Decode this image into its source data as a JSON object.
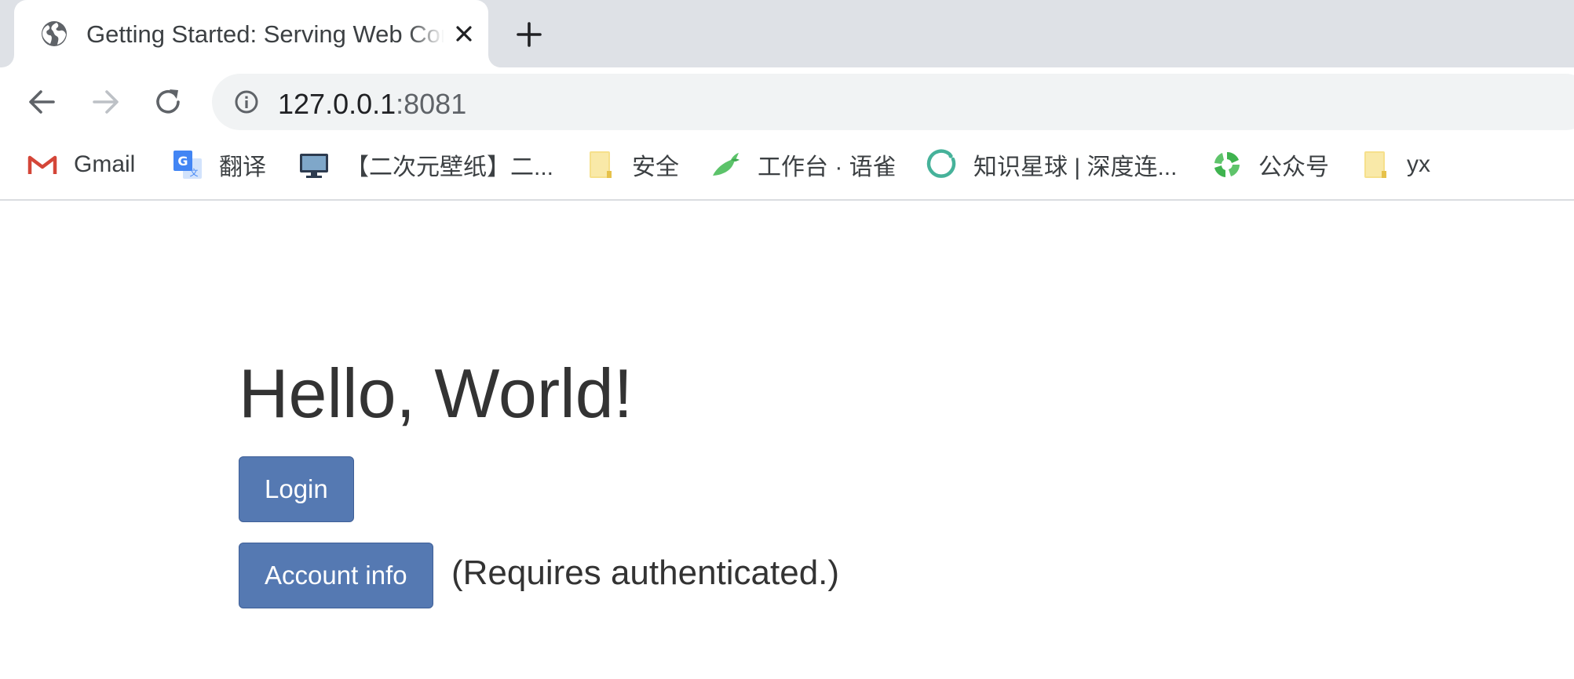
{
  "browser": {
    "tab": {
      "title": "Getting Started: Serving Web Content",
      "favicon": "globe-icon"
    },
    "address": {
      "host": "127.0.0.1",
      "port": ":8081"
    },
    "bookmarks": [
      {
        "label": "Gmail",
        "icon": "gmail-icon"
      },
      {
        "label": "翻译",
        "icon": "translate-icon"
      },
      {
        "label": "【二次元壁纸】二...",
        "icon": "monitor-icon"
      },
      {
        "label": "安全",
        "icon": "folder-icon"
      },
      {
        "label": "工作台 · 语雀",
        "icon": "yuque-icon"
      },
      {
        "label": "知识星球 | 深度连...",
        "icon": "zsxq-icon"
      },
      {
        "label": "公众号",
        "icon": "wechat-mp-icon"
      },
      {
        "label": "yx",
        "icon": "folder-icon"
      }
    ]
  },
  "page": {
    "heading": "Hello, World!",
    "login_button": "Login",
    "account_button": "Account info",
    "account_note": "(Requires authenticated.)"
  },
  "colors": {
    "button_bg": "#5579b2",
    "tabstrip_bg": "#dee1e6",
    "omnibox_bg": "#f1f3f4",
    "text": "#333333"
  }
}
